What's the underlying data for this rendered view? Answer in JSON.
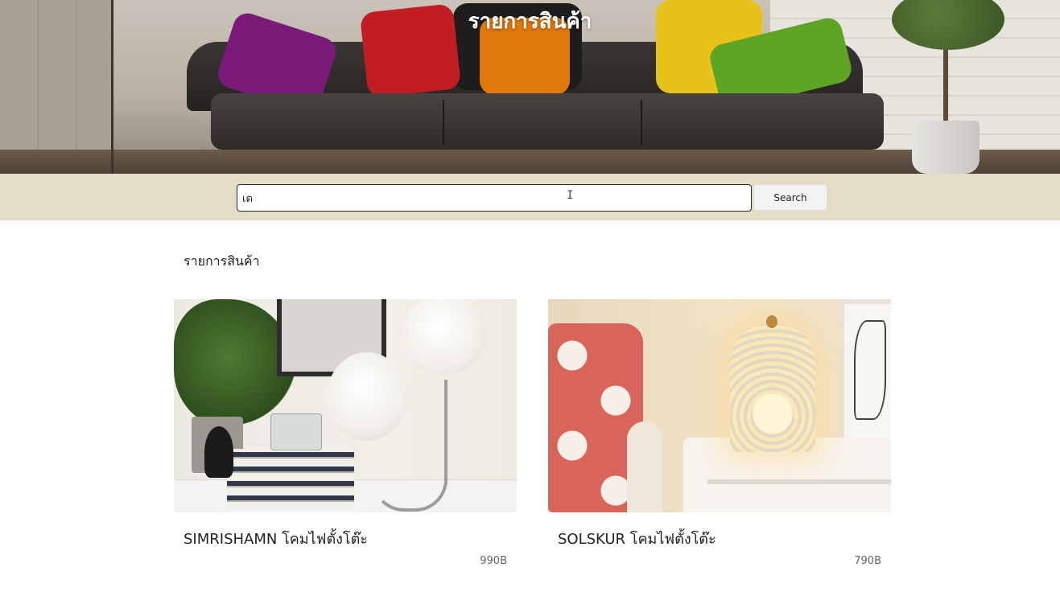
{
  "hero": {
    "title": "รายการสินค้า"
  },
  "search": {
    "value": "เต",
    "button_label": "Search"
  },
  "section": {
    "heading": "รายการสินค้า"
  },
  "products": [
    {
      "name": "SIMRISHAMN โคมไฟตั้งโต๊ะ",
      "price": "990B"
    },
    {
      "name": "SOLSKUR โคมไฟตั้งโต๊ะ",
      "price": "790B"
    }
  ],
  "colors": {
    "search_band": "#e4dcc4",
    "hero_title": "#ffffff"
  }
}
